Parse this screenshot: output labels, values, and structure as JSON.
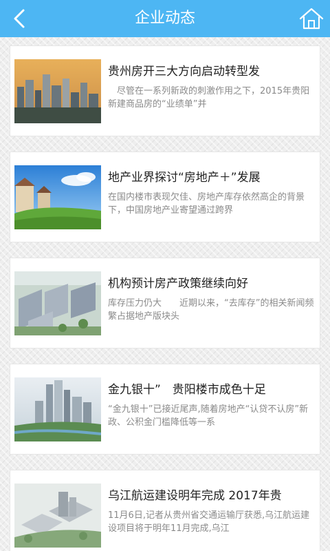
{
  "header": {
    "title": "企业动态"
  },
  "articles": [
    {
      "title": "贵州房开三大方向启动转型发",
      "summary": "　尽管在一系列新政的刺激作用之下，2015年贵阳新建商品房的“业绩单”并"
    },
    {
      "title": "地产业界探讨“房地产＋”发展",
      "summary": "在国内楼市表现欠佳、房地产库存依然高企的背景下，中国房地产业寄望通过跨界"
    },
    {
      "title": "机构预计房产政策继续向好",
      "summary": "库存压力仍大　　近期以来，“去库存”的相关新闻频繁占据地产版块头"
    },
    {
      "title": "金九银十”　贵阳楼市成色十足",
      "summary": "“金九银十”已接近尾声,随着房地产“认贷不认房”新政、公积金门槛降低等一系"
    },
    {
      "title": "乌江航运建设明年完成 2017年贵",
      "summary": "11月6日,记者从贵州省交通运输厅获悉,乌江航运建设项目将于明年11月完成,乌江"
    }
  ]
}
